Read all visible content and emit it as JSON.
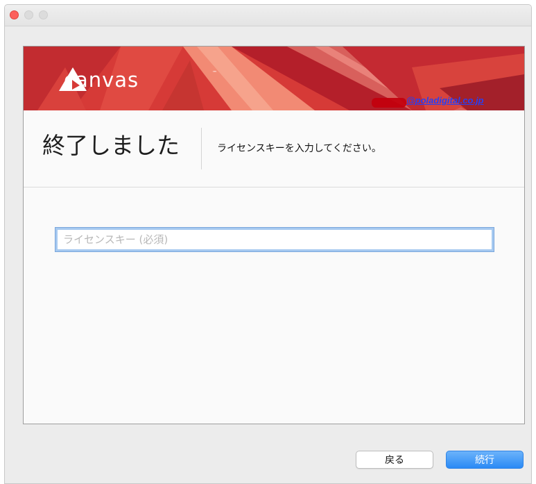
{
  "window": {
    "controls": [
      "close",
      "minimize",
      "maximize"
    ]
  },
  "banner": {
    "logo_text": "canvas",
    "logo_tm": "™",
    "email": "@poladigital.co.jp",
    "colors": {
      "primary": "#d83a38",
      "dark": "#a11d26",
      "light": "#f08a78"
    }
  },
  "header": {
    "title": "終了しました",
    "subtitle": "ライセンスキーを入力してください。"
  },
  "form": {
    "license_key": {
      "value": "",
      "placeholder": "ライセンスキー (必須)"
    }
  },
  "footer": {
    "back_label": "戻る",
    "continue_label": "続行",
    "accent_color": "#2a8af5"
  }
}
